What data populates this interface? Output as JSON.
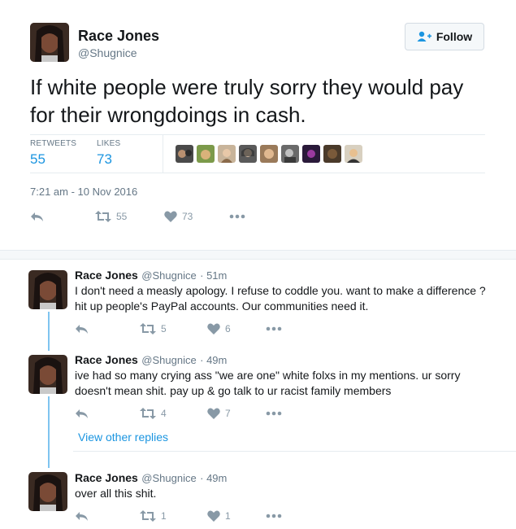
{
  "main_tweet": {
    "name": "Race Jones",
    "handle": "@Shugnice",
    "follow_label": "Follow",
    "text": "If white people were truly sorry they would pay for their wrongdoings in cash.",
    "retweets_label": "RETWEETS",
    "retweets": "55",
    "likes_label": "LIKES",
    "likes": "73",
    "timestamp": "7:21 am - 10 Nov 2016",
    "action_retweets": "55",
    "action_likes": "73"
  },
  "replies": [
    {
      "name": "Race Jones",
      "handle": "@Shugnice",
      "time": "· 51m",
      "text": "I don't need a measly apology. I refuse to coddle you. want to make a difference ? hit up people's PayPal accounts. Our communities need it.",
      "retweets": "5",
      "likes": "6"
    },
    {
      "name": "Race Jones",
      "handle": "@Shugnice",
      "time": "· 49m",
      "text": "ive had so many crying ass \"we are one\" white folxs in my mentions. ur sorry doesn't mean shit. pay up & go talk to ur racist family members",
      "retweets": "4",
      "likes": "7"
    },
    {
      "name": "Race Jones",
      "handle": "@Shugnice",
      "time": "· 49m",
      "text": "over all this shit.",
      "retweets": "1",
      "likes": "1"
    }
  ],
  "view_other_replies": "View other replies",
  "colors": {
    "accent": "#1b95e0",
    "muted": "#657786",
    "thread_line": "#7fc4f0"
  },
  "icons": [
    "reply-icon",
    "retweet-icon",
    "heart-icon",
    "more-icon",
    "follow-person-icon"
  ]
}
